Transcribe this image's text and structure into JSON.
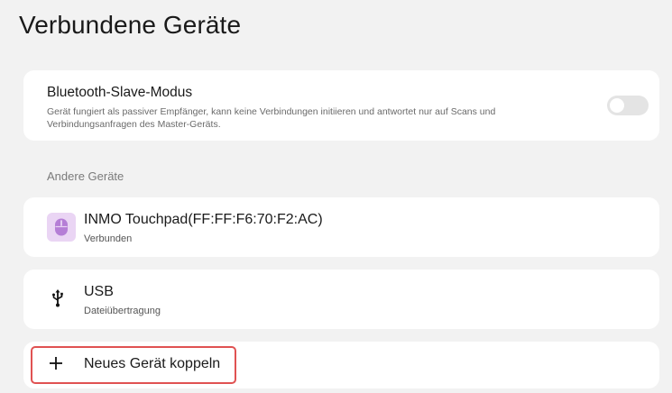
{
  "header": {
    "title": "Verbundene Geräte"
  },
  "bluetooth_slave": {
    "title": "Bluetooth-Slave-Modus",
    "description": "Gerät fungiert als passiver Empfänger, kann keine Verbindungen initiieren und antwortet nur auf Scans und Verbindungsanfragen des Master-Geräts.",
    "toggle_state": "off"
  },
  "other_devices": {
    "section_label": "Andere Geräte",
    "items": [
      {
        "name": "INMO Touchpad(FF:FF:F6:70:F2:AC)",
        "status": "Verbunden",
        "icon": "mouse-icon"
      },
      {
        "name": "USB",
        "status": "Dateiübertragung",
        "icon": "usb-icon"
      }
    ]
  },
  "pair": {
    "label": "Neues Gerät koppeln",
    "icon": "plus-icon"
  },
  "colors": {
    "background": "#f2f2f2",
    "card": "#ffffff",
    "icon_bg": "#ead5f4",
    "icon_fg": "#9a5cc4",
    "highlight": "#e05252"
  }
}
